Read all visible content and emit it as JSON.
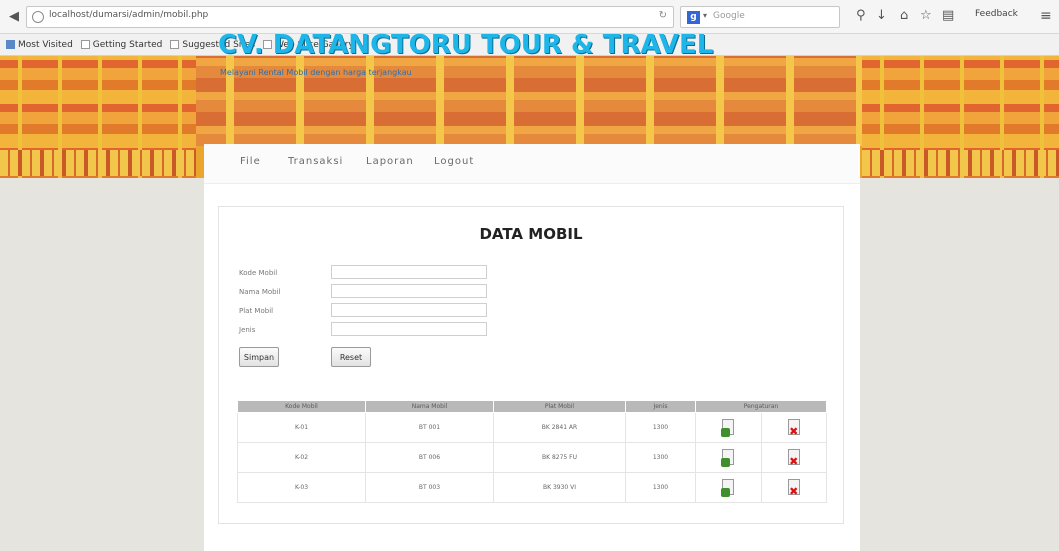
{
  "browser": {
    "url": "localhost/dumarsi/admin/mobil.php",
    "search_placeholder": "Google",
    "feedback_label": "Feedback",
    "bookmarks": [
      "Most Visited",
      "Getting Started",
      "Suggested Sites",
      "Web Slice Gallery"
    ]
  },
  "site": {
    "title": "CV. DATANGTORU TOUR & TRAVEL",
    "subtitle": "Melayani Rental Mobil dengan harga terjangkau",
    "nav": [
      "File",
      "Transaksi",
      "Laporan",
      "Logout"
    ]
  },
  "form": {
    "title": "DATA MOBIL",
    "fields": [
      {
        "label": "Kode Mobil",
        "value": ""
      },
      {
        "label": "Nama Mobil",
        "value": ""
      },
      {
        "label": "Plat Mobil",
        "value": ""
      },
      {
        "label": "Jenis",
        "value": ""
      }
    ],
    "save_label": "Simpan",
    "reset_label": "Reset"
  },
  "table": {
    "headers": [
      "Kode Mobil",
      "Nama Mobil",
      "Plat Mobil",
      "Jenis",
      "Pengaturan"
    ],
    "rows": [
      [
        "K-01",
        "BT 001",
        "BK 2841 AR",
        "1300"
      ],
      [
        "K-02",
        "BT 006",
        "BK 8275 FU",
        "1300"
      ],
      [
        "K-03",
        "BT 003",
        "BK 3930 VI",
        "1300"
      ]
    ]
  },
  "colors": {
    "title": "#1eb6e8",
    "banner": "#e9a52c",
    "header": "#b9b9b9"
  }
}
